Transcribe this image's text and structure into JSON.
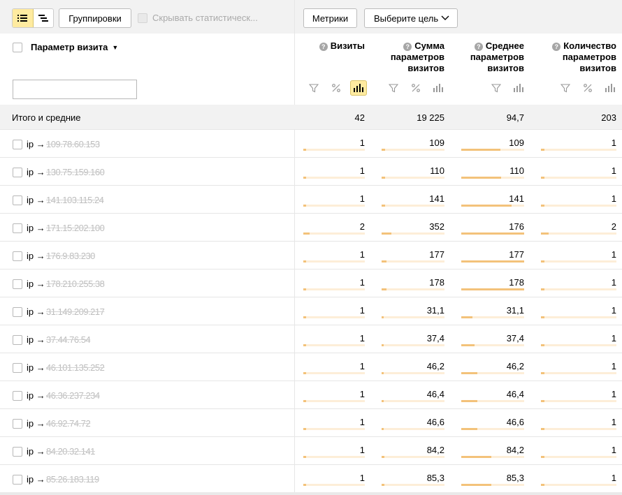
{
  "toolbar": {
    "group_label": "Группировки",
    "hide_stat_label": "Скрывать статистическ...",
    "metrics_label": "Метрики",
    "goal_label": "Выберите цель"
  },
  "header": {
    "param_label": "Параметр визита",
    "filter_placeholder": "",
    "columns": [
      {
        "lines": [
          "Визиты"
        ]
      },
      {
        "lines": [
          "Сумма",
          "параметров",
          "визитов"
        ]
      },
      {
        "lines": [
          "Среднее",
          "параметров",
          "визитов"
        ]
      },
      {
        "lines": [
          "Количество",
          "параметров",
          "визитов"
        ]
      }
    ]
  },
  "totals": {
    "label": "Итого и средние",
    "values": [
      "42",
      "19 225",
      "94,7",
      "203"
    ]
  },
  "rows": [
    {
      "prefix": "ip →",
      "ip": "109.78.60.153",
      "values": [
        "1",
        "109",
        "109",
        "1"
      ],
      "bars": [
        0.05,
        0.05,
        0.62,
        0.05
      ]
    },
    {
      "prefix": "ip →",
      "ip": "130.75.159.160",
      "values": [
        "1",
        "110",
        "110",
        "1"
      ],
      "bars": [
        0.05,
        0.05,
        0.63,
        0.05
      ]
    },
    {
      "prefix": "ip →",
      "ip": "141.103.115.24",
      "values": [
        "1",
        "141",
        "141",
        "1"
      ],
      "bars": [
        0.05,
        0.06,
        0.8,
        0.05
      ]
    },
    {
      "prefix": "ip →",
      "ip": "171.15.202.100",
      "values": [
        "2",
        "352",
        "176",
        "2"
      ],
      "bars": [
        0.1,
        0.15,
        1.0,
        0.1
      ]
    },
    {
      "prefix": "ip →",
      "ip": "176.9.83.230",
      "values": [
        "1",
        "177",
        "177",
        "1"
      ],
      "bars": [
        0.05,
        0.08,
        1.0,
        0.05
      ]
    },
    {
      "prefix": "ip →",
      "ip": "178.210.255.38",
      "values": [
        "1",
        "178",
        "178",
        "1"
      ],
      "bars": [
        0.05,
        0.08,
        1.0,
        0.05
      ]
    },
    {
      "prefix": "ip →",
      "ip": "31.149.209.217",
      "values": [
        "1",
        "31,1",
        "31,1",
        "1"
      ],
      "bars": [
        0.05,
        0.02,
        0.18,
        0.05
      ]
    },
    {
      "prefix": "ip →",
      "ip": "37.44.76.54",
      "values": [
        "1",
        "37,4",
        "37,4",
        "1"
      ],
      "bars": [
        0.05,
        0.02,
        0.21,
        0.05
      ]
    },
    {
      "prefix": "ip →",
      "ip": "46.101.135.252",
      "values": [
        "1",
        "46,2",
        "46,2",
        "1"
      ],
      "bars": [
        0.05,
        0.02,
        0.26,
        0.05
      ]
    },
    {
      "prefix": "ip →",
      "ip": "46.36.237.234",
      "values": [
        "1",
        "46,4",
        "46,4",
        "1"
      ],
      "bars": [
        0.05,
        0.02,
        0.26,
        0.05
      ]
    },
    {
      "prefix": "ip →",
      "ip": "46.92.74.72",
      "values": [
        "1",
        "46,6",
        "46,6",
        "1"
      ],
      "bars": [
        0.05,
        0.02,
        0.26,
        0.05
      ]
    },
    {
      "prefix": "ip →",
      "ip": "84.20.32.141",
      "values": [
        "1",
        "84,2",
        "84,2",
        "1"
      ],
      "bars": [
        0.05,
        0.04,
        0.48,
        0.05
      ]
    },
    {
      "prefix": "ip →",
      "ip": "85.26.183.119",
      "values": [
        "1",
        "85,3",
        "85,3",
        "1"
      ],
      "bars": [
        0.05,
        0.04,
        0.48,
        0.05
      ]
    }
  ]
}
